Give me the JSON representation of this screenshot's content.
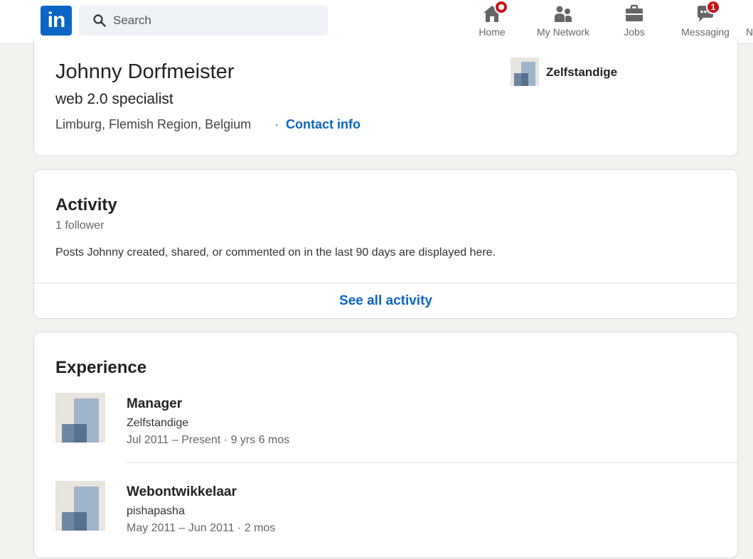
{
  "nav": {
    "logo_text": "in",
    "search_placeholder": "Search",
    "items": [
      {
        "label": "Home",
        "icon": "home-icon"
      },
      {
        "label": "My Network",
        "icon": "network-icon"
      },
      {
        "label": "Jobs",
        "icon": "briefcase-icon"
      },
      {
        "label": "Messaging",
        "icon": "messaging-icon",
        "badge": "1"
      }
    ],
    "cut_off_label": "N",
    "accent": "#0a66c2",
    "badge_color": "#cc1016"
  },
  "profile": {
    "name": "Johnny Dorfmeister",
    "headline": "web 2.0 specialist",
    "location": "Limburg, Flemish Region, Belgium",
    "separator": "·",
    "contact_label": "Contact info",
    "current_company": "Zelfstandige"
  },
  "activity": {
    "title": "Activity",
    "followers": "1 follower",
    "description": "Posts Johnny created, shared, or commented on in the last 90 days are displayed here.",
    "see_all_label": "See all activity"
  },
  "experience": {
    "title": "Experience",
    "items": [
      {
        "title": "Manager",
        "company": "Zelfstandige",
        "dates": "Jul 2011 – Present · 9 yrs 6 mos"
      },
      {
        "title": "Webontwikkelaar",
        "company": "pishapasha",
        "dates": "May 2011 – Jun 2011 · 2 mos"
      }
    ]
  }
}
